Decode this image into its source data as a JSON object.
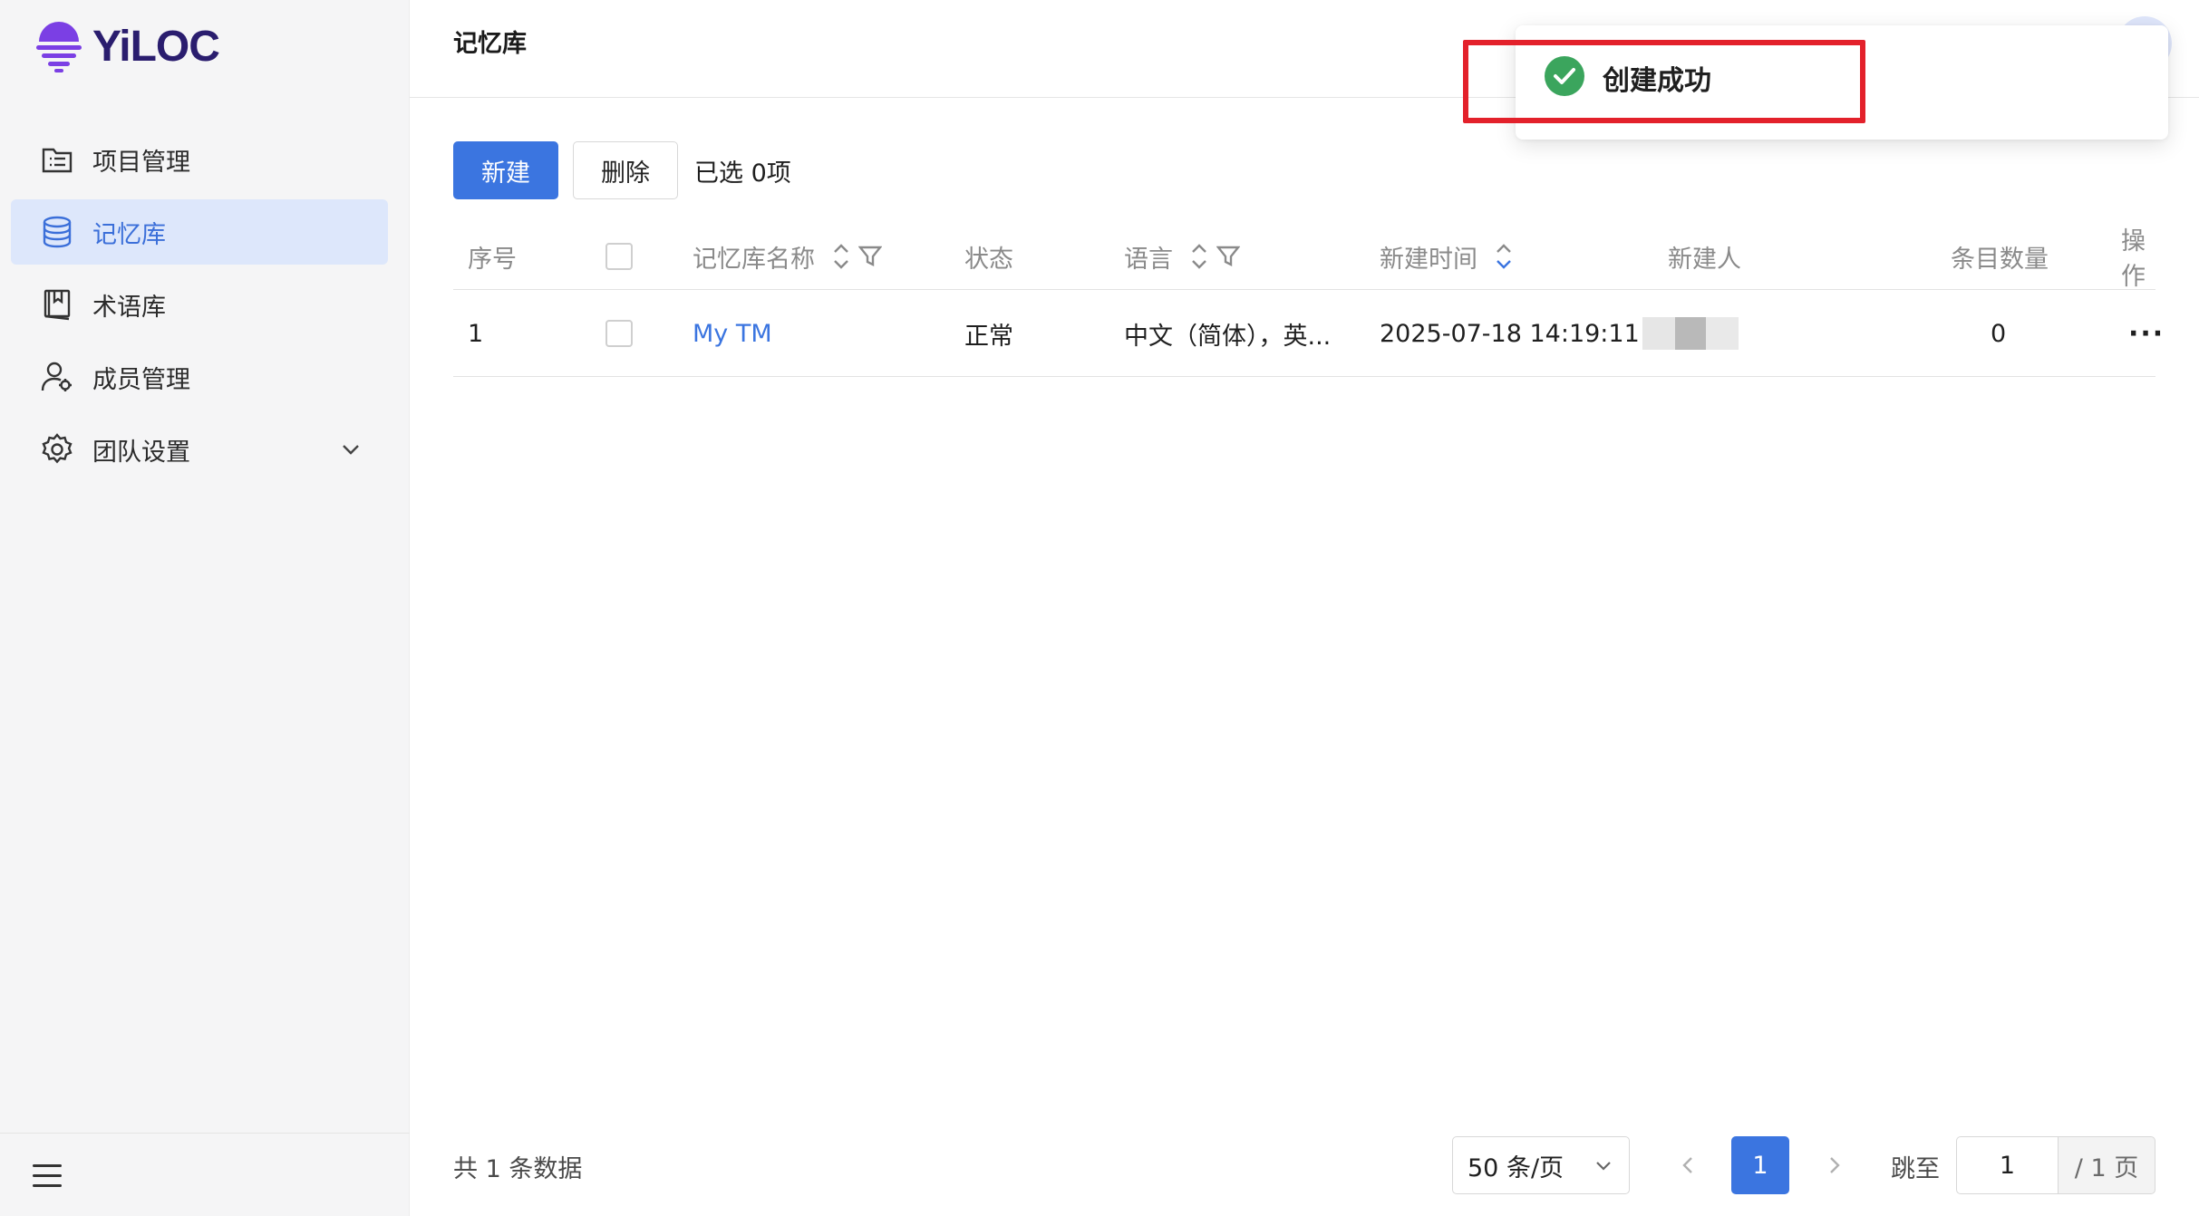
{
  "brand": {
    "name": "YiLOC",
    "colors": {
      "primary": "#3b75e0",
      "logo": "#7b3fe4",
      "success": "#3ba55d",
      "highlight": "#e3212b"
    }
  },
  "sidebar": {
    "items": [
      {
        "label": "项目管理",
        "icon": "folder-list-icon",
        "active": false
      },
      {
        "label": "记忆库",
        "icon": "database-icon",
        "active": true
      },
      {
        "label": "术语库",
        "icon": "book-icon",
        "active": false
      },
      {
        "label": "成员管理",
        "icon": "user-settings-icon",
        "active": false
      },
      {
        "label": "团队设置",
        "icon": "gear-icon",
        "active": false,
        "expandable": true
      }
    ]
  },
  "header": {
    "title": "记忆库"
  },
  "toolbar": {
    "new_label": "新建",
    "delete_label": "删除",
    "selected_text": "已选 0项"
  },
  "table": {
    "columns": [
      "序号",
      "记忆库名称",
      "状态",
      "语言",
      "新建时间",
      "新建人",
      "条目数量",
      "操作"
    ],
    "rows": [
      {
        "index": "1",
        "name": "My TM",
        "status": "正常",
        "language": "中文（简体），英...",
        "created": "2025-07-18 14:19:11",
        "creator": "",
        "count": "0",
        "action": "···"
      }
    ]
  },
  "footer": {
    "total": "共 1 条数据",
    "page_size": "50 条/页",
    "current_page": "1",
    "jump_label": "跳至",
    "jump_value": "1",
    "page_suffix": "/ 1 页"
  },
  "toast": {
    "message": "创建成功",
    "icon": "check-circle-icon"
  }
}
